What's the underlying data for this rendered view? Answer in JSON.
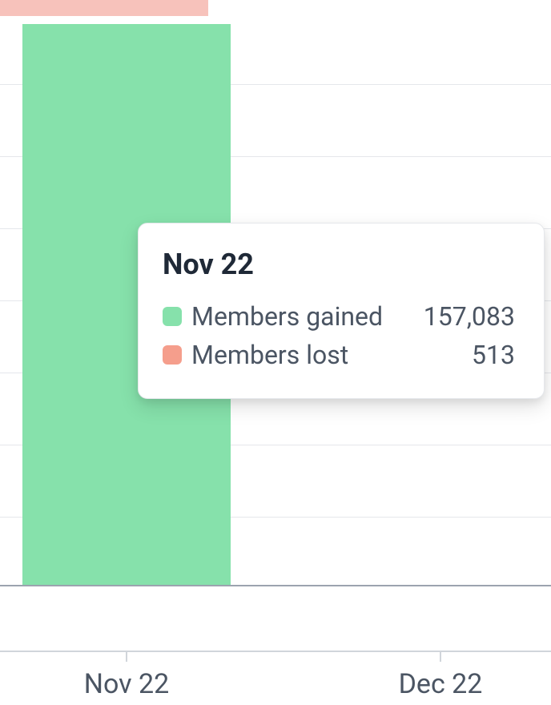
{
  "chart_data": {
    "type": "bar",
    "categories": [
      "Nov 22",
      "Dec 22"
    ],
    "series": [
      {
        "name": "Members gained",
        "values": [
          157083,
          null
        ],
        "color": "#86e1ab"
      },
      {
        "name": "Members lost",
        "values": [
          513,
          null
        ],
        "color": "#f59e8c"
      }
    ],
    "xlabel": "",
    "ylabel": ""
  },
  "tooltip": {
    "title": "Nov 22",
    "rows": [
      {
        "label": "Members gained",
        "value": "157,083"
      },
      {
        "label": "Members lost",
        "value": "513"
      }
    ]
  },
  "xaxis": {
    "ticks": [
      "Nov 22",
      "Dec 22"
    ]
  }
}
